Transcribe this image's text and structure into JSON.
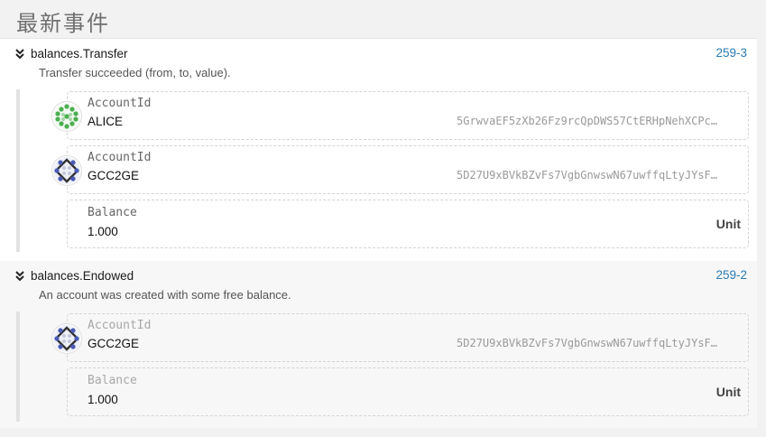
{
  "page": {
    "title": "最新事件"
  },
  "events": [
    {
      "name": "balances.Transfer",
      "description": "Transfer succeeded (from, to, value).",
      "id": "259-3",
      "params": [
        {
          "label": "AccountId",
          "value": "ALICE",
          "address": "5GrwvaEF5zXb26Fz9rcQpDWS57CtERHpNehXCPc…",
          "icon": "identicon-green"
        },
        {
          "label": "AccountId",
          "value": "GCC2GE",
          "address": "5D27U9xBVkBZvFs7VgbGnwswN67uwffqLtyJYsF…",
          "icon": "identicon-blue"
        },
        {
          "label": "Balance",
          "value": "1.000",
          "unit": "Unit"
        }
      ]
    },
    {
      "name": "balances.Endowed",
      "description": "An account was created with some free balance.",
      "id": "259-2",
      "params": [
        {
          "label": "AccountId",
          "value": "GCC2GE",
          "address": "5D27U9xBVkBZvFs7VgbGnwswN67uwffqLtyJYsF…",
          "icon": "identicon-blue"
        },
        {
          "label": "Balance",
          "value": "1.000",
          "unit": "Unit"
        }
      ]
    }
  ],
  "icons": {
    "collapse": "chevron-double-down-icon"
  },
  "colors": {
    "link": "#2b7bb2",
    "identicon_green": "#4caf50",
    "identicon_blue": "#4b5bb5"
  }
}
